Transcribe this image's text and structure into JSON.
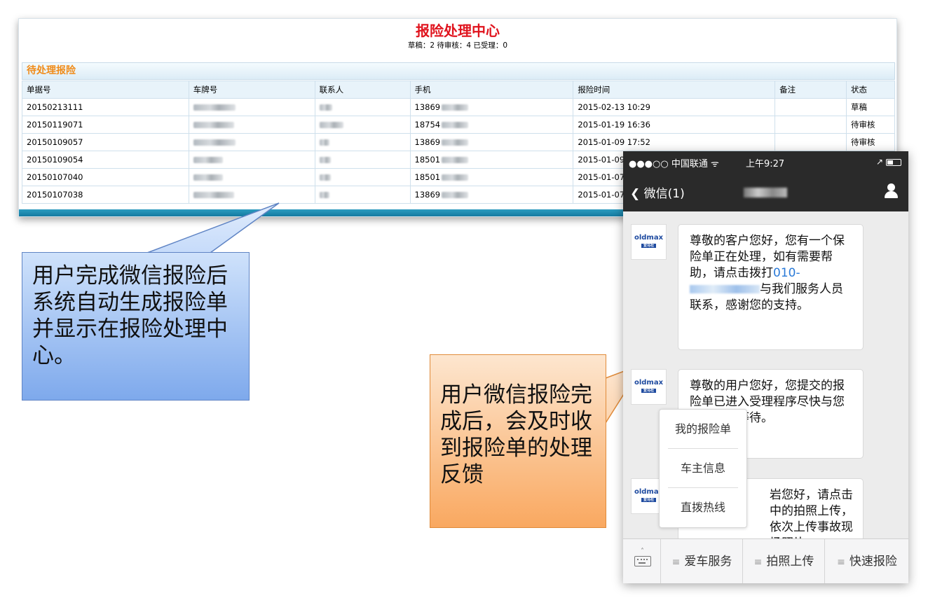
{
  "claims_panel": {
    "title": "报险处理中心",
    "summary": "草稿：2 待审核：4 已受理：0",
    "section_title": "待处理报险",
    "columns": [
      "单据号",
      "车牌号",
      "联系人",
      "手机",
      "报险时间",
      "备注",
      "状态"
    ],
    "rows": [
      {
        "id": "20150213111",
        "phone": "13869",
        "time": "2015-02-13 10:29",
        "status": "草稿"
      },
      {
        "id": "20150119071",
        "phone": "18754",
        "time": "2015-01-19 16:36",
        "status": "待审核"
      },
      {
        "id": "20150109057",
        "phone": "13869",
        "time": "2015-01-09 17:52",
        "status": "待审核"
      },
      {
        "id": "20150109054",
        "phone": "18501",
        "time": "2015-01-09",
        "status": ""
      },
      {
        "id": "20150107040",
        "phone": "18501",
        "time": "2015-01-07",
        "status": ""
      },
      {
        "id": "20150107038",
        "phone": "13869",
        "time": "2015-01-07",
        "status": ""
      }
    ]
  },
  "callouts": {
    "left": "用户完成微信报险后系统自动生成报险单并显示在报险处理中心。",
    "right": "用户微信报险完成后，会及时收到报险单的处理反馈"
  },
  "phone": {
    "status": {
      "carrier": "●●●○○ 中国联通 ᯤ",
      "time": "上午9:27",
      "right": "↗"
    },
    "nav": {
      "back_label": "微信(1)"
    },
    "avatar_brand": "oldmax",
    "avatar_sub": "爱马社",
    "messages": [
      {
        "text_before": "尊敬的客户您好，您有一个保险单正在处理，如有需要帮助，请点击拨打",
        "phone_prefix": "010-",
        "text_after": "与我们服务人员联系，感谢您的支持。"
      },
      {
        "text": "尊敬的用户您好，您提交的报险单已进入受理程序尽快与您取得联心等待。"
      },
      {
        "text": "岩您好，请点击中的拍照上传，依次上传事故现场照片。"
      }
    ],
    "popup_menu": [
      "我的报险单",
      "车主信息",
      "直拨热线"
    ],
    "menu_bar": [
      "爱车服务",
      "拍照上传",
      "快速报险"
    ],
    "menu_eq_icon": "≡"
  }
}
